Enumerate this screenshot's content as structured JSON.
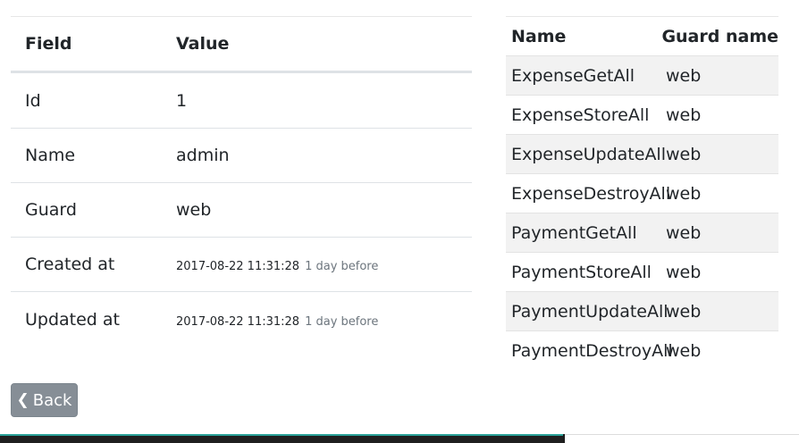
{
  "details": {
    "header": {
      "field": "Field",
      "value": "Value"
    },
    "rows": [
      {
        "label": "Id",
        "value": "1"
      },
      {
        "label": "Name",
        "value": "admin"
      },
      {
        "label": "Guard",
        "value": "web"
      },
      {
        "label": "Created at",
        "timestamp": "2017-08-22 11:31:28",
        "ago": "1 day before"
      },
      {
        "label": "Updated at",
        "timestamp": "2017-08-22 11:31:28",
        "ago": "1 day before"
      }
    ]
  },
  "permissions": {
    "header": {
      "name": "Name",
      "guard": "Guard name"
    },
    "rows": [
      {
        "name": "ExpenseGetAll",
        "guard": "web"
      },
      {
        "name": "ExpenseStoreAll",
        "guard": "web"
      },
      {
        "name": "ExpenseUpdateAll",
        "guard": "web"
      },
      {
        "name": "ExpenseDestroyAll",
        "guard": "web"
      },
      {
        "name": "PaymentGetAll",
        "guard": "web"
      },
      {
        "name": "PaymentStoreAll",
        "guard": "web"
      },
      {
        "name": "PaymentUpdateAll",
        "guard": "web"
      },
      {
        "name": "PaymentDestroyAll",
        "guard": "web"
      }
    ]
  },
  "back_button": {
    "label": "Back",
    "icon": "chevron-left-icon"
  },
  "colors": {
    "button_bg": "#868e96",
    "stripe": "#f2f2f2",
    "muted_text": "#6c757d"
  }
}
